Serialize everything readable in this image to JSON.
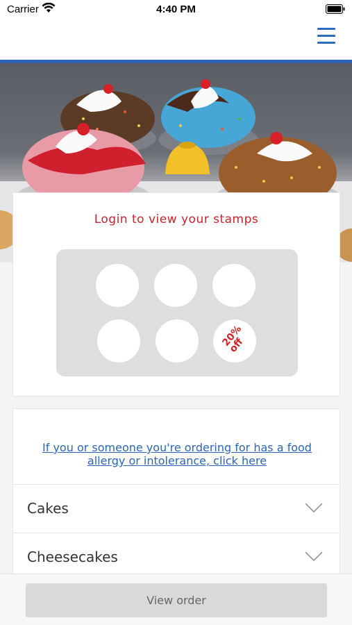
{
  "status_bar": {
    "carrier": "Carrier",
    "time": "4:40 PM"
  },
  "nav": {
    "menu_icon": "hamburger-icon",
    "accent_color": "#2d63b4"
  },
  "loyalty": {
    "title": "Login to view your stamps",
    "stamps_total": 6,
    "reward_text_line1": "20%",
    "reward_text_line2": "off",
    "reward_color": "#c8242b"
  },
  "menu": {
    "allergy_link": "If you or someone you're ordering for has a food allergy or intolerance, click here",
    "categories": [
      {
        "label": "Cakes",
        "icon": "chevron-down-icon"
      },
      {
        "label": "Cheesecakes",
        "icon": "chevron-down-icon"
      }
    ]
  },
  "footer": {
    "view_order_label": "View order"
  }
}
